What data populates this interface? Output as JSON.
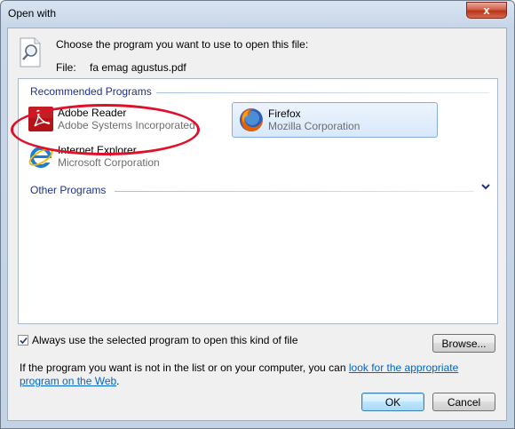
{
  "window": {
    "title": "Open with",
    "close_glyph": "x"
  },
  "header": {
    "prompt": "Choose the program you want to use to open this file:",
    "file_label": "File:",
    "file_name": "fa emag agustus.pdf",
    "icon": "magnifier-document-icon"
  },
  "recommended": {
    "header": "Recommended Programs",
    "programs": [
      {
        "name": "Adobe Reader",
        "company": "Adobe Systems Incorporated",
        "icon": "adobe-reader-icon"
      },
      {
        "name": "Firefox",
        "company": "Mozilla Corporation",
        "icon": "firefox-icon",
        "selected": true
      },
      {
        "name": "Internet Explorer",
        "company": "Microsoft Corporation",
        "icon": "internet-explorer-icon"
      }
    ]
  },
  "other": {
    "header": "Other Programs",
    "icon": "chevron-down-icon"
  },
  "always_use": {
    "label": "Always use the selected program to open this kind of file",
    "checked": true
  },
  "buttons": {
    "browse": "Browse...",
    "ok": "OK",
    "cancel": "Cancel"
  },
  "help": {
    "text": "If the program you want is not in the list or on your computer, you can ",
    "link": "look for the appropriate program on the Web",
    "end": "."
  },
  "colors": {
    "group_header": "#1e3287",
    "link": "#0066cc",
    "annotation": "#e0102a"
  }
}
